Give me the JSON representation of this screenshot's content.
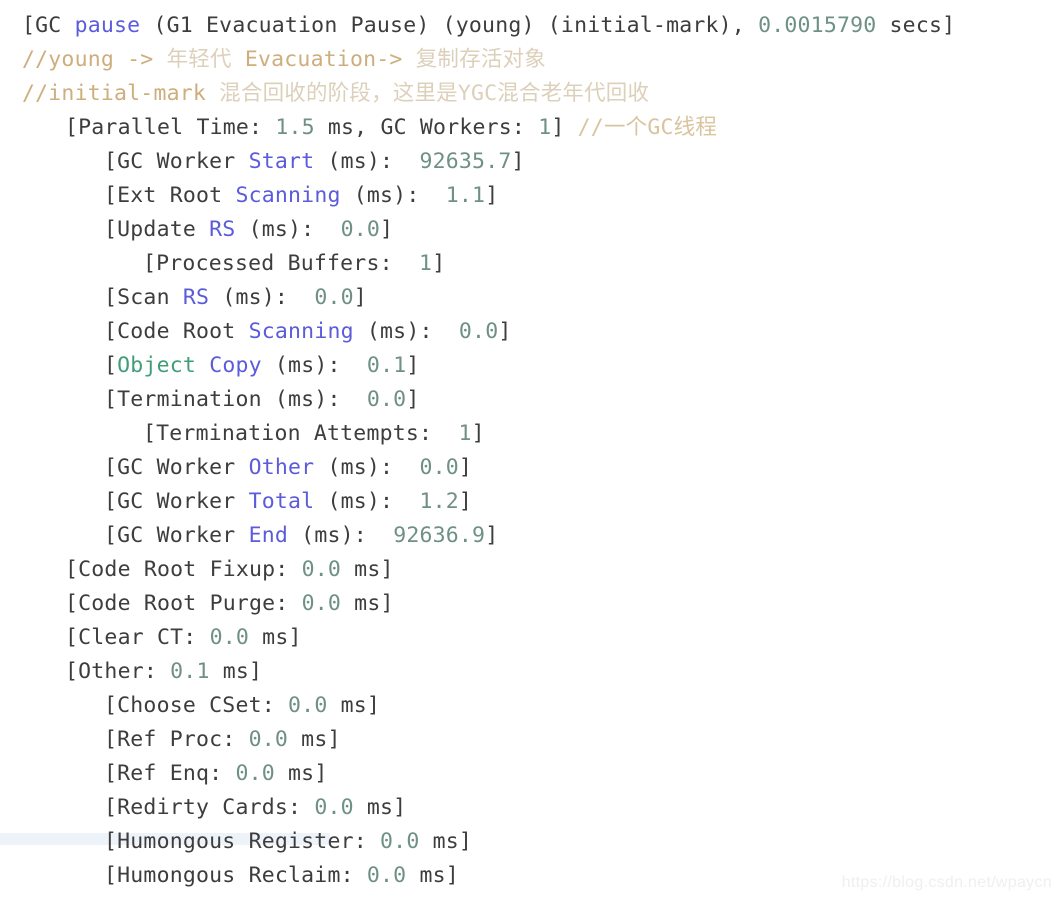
{
  "page": {
    "title": "G1 Evacuation Pause GC log",
    "background": "#ffffff",
    "watermark": "https://blog.csdn.net/wpaycn"
  },
  "colors": {
    "plain": "#3d3d3d",
    "keyword": "#5b5bdb",
    "type": "#3f9e78",
    "number": "#6f9183",
    "comment": "#cdae7c",
    "comment_cjk": "#ddd0bb",
    "highlight_band": "#eef3fa"
  },
  "lines": [
    {
      "indent": 0,
      "tokens": [
        {
          "text": "[GC ",
          "kind": "plain"
        },
        {
          "text": "pause",
          "kind": "keyword"
        },
        {
          "text": " (G1 Evacuation Pause) (young) (initial-mark), ",
          "kind": "plain"
        },
        {
          "text": "0.0015790",
          "kind": "number"
        },
        {
          "text": " secs]",
          "kind": "plain"
        }
      ]
    },
    {
      "indent": 0,
      "tokens": [
        {
          "text": "//young -> ",
          "kind": "comment"
        },
        {
          "text": "年轻代",
          "kind": "comment_cjk"
        },
        {
          "text": " Evacuation-> ",
          "kind": "comment"
        },
        {
          "text": "复制存活对象",
          "kind": "comment_cjk"
        }
      ]
    },
    {
      "indent": 0,
      "tokens": [
        {
          "text": "//initial-mark ",
          "kind": "comment"
        },
        {
          "text": "混合回收的阶段，这里是YGC混合老年代回收",
          "kind": "comment_cjk"
        }
      ]
    },
    {
      "indent": 1,
      "tokens": [
        {
          "text": "[Parallel Time: ",
          "kind": "plain"
        },
        {
          "text": "1.5",
          "kind": "number"
        },
        {
          "text": " ms, GC Workers: ",
          "kind": "plain"
        },
        {
          "text": "1",
          "kind": "number"
        },
        {
          "text": "] ",
          "kind": "plain"
        },
        {
          "text": "//一个GC线程",
          "kind": "comment_inline"
        }
      ]
    },
    {
      "indent": 2,
      "tokens": [
        {
          "text": "[GC Worker ",
          "kind": "plain"
        },
        {
          "text": "Start",
          "kind": "keyword"
        },
        {
          "text": " (ms):  ",
          "kind": "plain"
        },
        {
          "text": "92635.7",
          "kind": "number"
        },
        {
          "text": "]",
          "kind": "plain"
        }
      ]
    },
    {
      "indent": 2,
      "tokens": [
        {
          "text": "[Ext Root ",
          "kind": "plain"
        },
        {
          "text": "Scanning",
          "kind": "keyword"
        },
        {
          "text": " (ms):  ",
          "kind": "plain"
        },
        {
          "text": "1.1",
          "kind": "number"
        },
        {
          "text": "]",
          "kind": "plain"
        }
      ]
    },
    {
      "indent": 2,
      "tokens": [
        {
          "text": "[Update ",
          "kind": "plain"
        },
        {
          "text": "RS",
          "kind": "keyword"
        },
        {
          "text": " (ms):  ",
          "kind": "plain"
        },
        {
          "text": "0.0",
          "kind": "number"
        },
        {
          "text": "]",
          "kind": "plain"
        }
      ]
    },
    {
      "indent": 3,
      "tokens": [
        {
          "text": "[Processed Buffers:  ",
          "kind": "plain"
        },
        {
          "text": "1",
          "kind": "number"
        },
        {
          "text": "]",
          "kind": "plain"
        }
      ]
    },
    {
      "indent": 2,
      "tokens": [
        {
          "text": "[Scan ",
          "kind": "plain"
        },
        {
          "text": "RS",
          "kind": "keyword"
        },
        {
          "text": " (ms):  ",
          "kind": "plain"
        },
        {
          "text": "0.0",
          "kind": "number"
        },
        {
          "text": "]",
          "kind": "plain"
        }
      ]
    },
    {
      "indent": 2,
      "tokens": [
        {
          "text": "[Code Root ",
          "kind": "plain"
        },
        {
          "text": "Scanning",
          "kind": "keyword"
        },
        {
          "text": " (ms):  ",
          "kind": "plain"
        },
        {
          "text": "0.0",
          "kind": "number"
        },
        {
          "text": "]",
          "kind": "plain"
        }
      ]
    },
    {
      "indent": 2,
      "tokens": [
        {
          "text": "[",
          "kind": "plain"
        },
        {
          "text": "Object",
          "kind": "type"
        },
        {
          "text": " ",
          "kind": "plain"
        },
        {
          "text": "Copy",
          "kind": "keyword"
        },
        {
          "text": " (ms):  ",
          "kind": "plain"
        },
        {
          "text": "0.1",
          "kind": "number"
        },
        {
          "text": "]",
          "kind": "plain"
        }
      ]
    },
    {
      "indent": 2,
      "tokens": [
        {
          "text": "[Termination (ms):  ",
          "kind": "plain"
        },
        {
          "text": "0.0",
          "kind": "number"
        },
        {
          "text": "]",
          "kind": "plain"
        }
      ]
    },
    {
      "indent": 3,
      "tokens": [
        {
          "text": "[Termination Attempts:  ",
          "kind": "plain"
        },
        {
          "text": "1",
          "kind": "number"
        },
        {
          "text": "]",
          "kind": "plain"
        }
      ]
    },
    {
      "indent": 2,
      "tokens": [
        {
          "text": "[GC Worker ",
          "kind": "plain"
        },
        {
          "text": "Other",
          "kind": "keyword"
        },
        {
          "text": " (ms):  ",
          "kind": "plain"
        },
        {
          "text": "0.0",
          "kind": "number"
        },
        {
          "text": "]",
          "kind": "plain"
        }
      ]
    },
    {
      "indent": 2,
      "tokens": [
        {
          "text": "[GC Worker ",
          "kind": "plain"
        },
        {
          "text": "Total",
          "kind": "keyword"
        },
        {
          "text": " (ms):  ",
          "kind": "plain"
        },
        {
          "text": "1.2",
          "kind": "number"
        },
        {
          "text": "]",
          "kind": "plain"
        }
      ]
    },
    {
      "indent": 2,
      "tokens": [
        {
          "text": "[GC Worker ",
          "kind": "plain"
        },
        {
          "text": "End",
          "kind": "keyword"
        },
        {
          "text": " (ms):  ",
          "kind": "plain"
        },
        {
          "text": "92636.9",
          "kind": "number"
        },
        {
          "text": "]",
          "kind": "plain"
        }
      ]
    },
    {
      "indent": 1,
      "tokens": [
        {
          "text": "[Code Root Fixup: ",
          "kind": "plain"
        },
        {
          "text": "0.0",
          "kind": "number"
        },
        {
          "text": " ms]",
          "kind": "plain"
        }
      ]
    },
    {
      "indent": 1,
      "tokens": [
        {
          "text": "[Code Root Purge: ",
          "kind": "plain"
        },
        {
          "text": "0.0",
          "kind": "number"
        },
        {
          "text": " ms]",
          "kind": "plain"
        }
      ]
    },
    {
      "indent": 1,
      "tokens": [
        {
          "text": "[Clear CT: ",
          "kind": "plain"
        },
        {
          "text": "0.0",
          "kind": "number"
        },
        {
          "text": " ms]",
          "kind": "plain"
        }
      ]
    },
    {
      "indent": 1,
      "tokens": [
        {
          "text": "[Other: ",
          "kind": "plain"
        },
        {
          "text": "0.1",
          "kind": "number"
        },
        {
          "text": " ms]",
          "kind": "plain"
        }
      ]
    },
    {
      "indent": 2,
      "tokens": [
        {
          "text": "[Choose CSet: ",
          "kind": "plain"
        },
        {
          "text": "0.0",
          "kind": "number"
        },
        {
          "text": " ms]",
          "kind": "plain"
        }
      ]
    },
    {
      "indent": 2,
      "tokens": [
        {
          "text": "[Ref Proc: ",
          "kind": "plain"
        },
        {
          "text": "0.0",
          "kind": "number"
        },
        {
          "text": " ms]",
          "kind": "plain"
        }
      ]
    },
    {
      "indent": 2,
      "tokens": [
        {
          "text": "[Ref Enq: ",
          "kind": "plain"
        },
        {
          "text": "0.0",
          "kind": "number"
        },
        {
          "text": " ms]",
          "kind": "plain"
        }
      ]
    },
    {
      "indent": 2,
      "tokens": [
        {
          "text": "[Redirty Cards: ",
          "kind": "plain"
        },
        {
          "text": "0.0",
          "kind": "number"
        },
        {
          "text": " ms]",
          "kind": "plain"
        }
      ]
    },
    {
      "indent": 2,
      "tokens": [
        {
          "text": "[Humongous Register: ",
          "kind": "plain"
        },
        {
          "text": "0.0",
          "kind": "number"
        },
        {
          "text": " ms]",
          "kind": "plain"
        }
      ]
    },
    {
      "indent": 2,
      "tokens": [
        {
          "text": "[Humongous Reclaim: ",
          "kind": "plain"
        },
        {
          "text": "0.0",
          "kind": "number"
        },
        {
          "text": " ms]",
          "kind": "plain"
        }
      ]
    }
  ]
}
